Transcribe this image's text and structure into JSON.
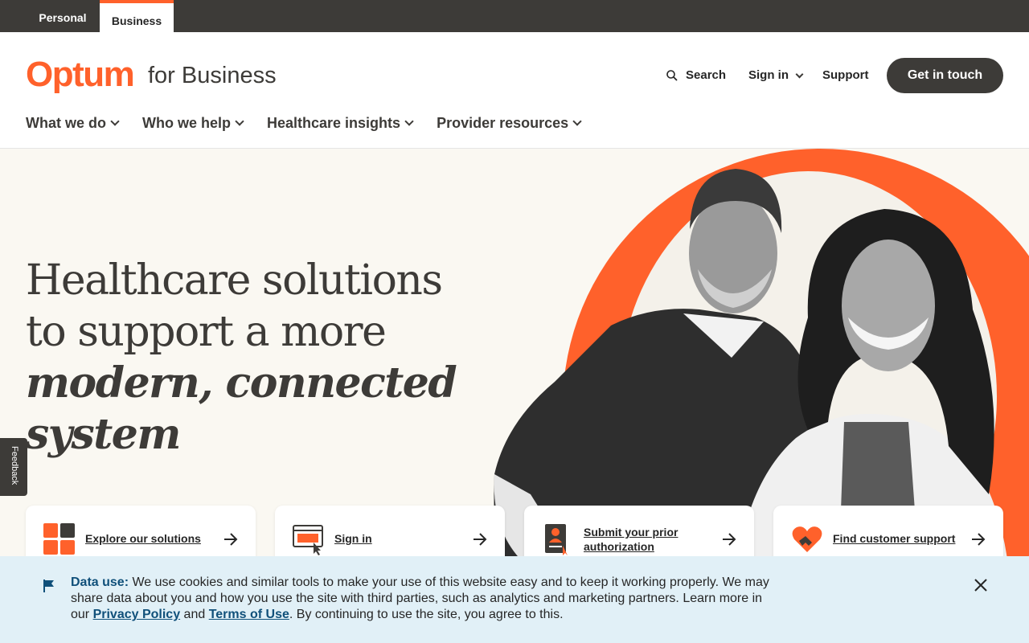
{
  "topbar": {
    "personal_label": "Personal",
    "business_label": "Business"
  },
  "header": {
    "logo": "Optum",
    "logo_sub": "for Business",
    "search_label": "Search",
    "signin_label": "Sign in",
    "support_label": "Support",
    "cta_label": "Get in touch"
  },
  "nav": {
    "items": [
      {
        "label": "What we do"
      },
      {
        "label": "Who we help"
      },
      {
        "label": "Healthcare insights"
      },
      {
        "label": "Provider resources"
      }
    ]
  },
  "hero": {
    "line1": "Healthcare solutions",
    "line2": "to support a more",
    "line3": "modern, connected",
    "line4": "system"
  },
  "feedback": {
    "label": "Feedback"
  },
  "cards": [
    {
      "label": "Explore our solutions",
      "icon": "grid-icon"
    },
    {
      "label": "Sign in",
      "icon": "browser-click-icon"
    },
    {
      "label": "Submit your prior authorization",
      "icon": "document-user-icon"
    },
    {
      "label": "Find customer support",
      "icon": "heart-handshake-icon"
    }
  ],
  "cookie": {
    "title": "Data use:",
    "text1": " We use cookies and similar tools to make your use of this website easy and to keep it working properly. We may share data about you and how you use the site with third parties, such as analytics and marketing partners. Learn more in our ",
    "privacy_link": "Privacy Policy",
    "and": " and ",
    "terms_link": "Terms of Use",
    "text2": ". By continuing to use the site, you agree to this."
  },
  "colors": {
    "brand_orange": "#ff612b",
    "dark": "#3d3b38",
    "hero_bg": "#faf8f2",
    "cookie_bg": "#e1f0f7",
    "link_blue": "#10507a"
  }
}
